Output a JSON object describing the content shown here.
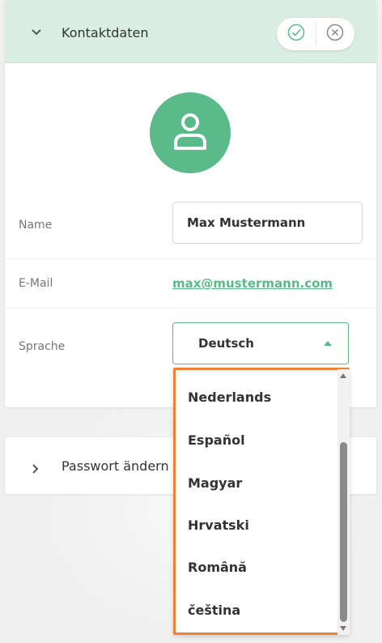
{
  "contact": {
    "title": "Kontaktdaten",
    "confirm_icon": "check-circle-icon",
    "cancel_icon": "x-circle-icon",
    "avatar_icon": "user-icon"
  },
  "form": {
    "name_label": "Name",
    "name_value": "Max Mustermann",
    "email_label": "E-Mail",
    "email_value": "max@mustermann.com",
    "language_label": "Sprache",
    "language_value": "Deutsch"
  },
  "password": {
    "title": "Passwort ändern"
  },
  "language_options": [
    "Nederlands",
    "Español",
    "Magyar",
    "Hrvatski",
    "Română",
    "čeština"
  ],
  "colors": {
    "accent": "#5aba8a",
    "header_bg": "#dbeee3",
    "highlight": "#f0812f"
  }
}
